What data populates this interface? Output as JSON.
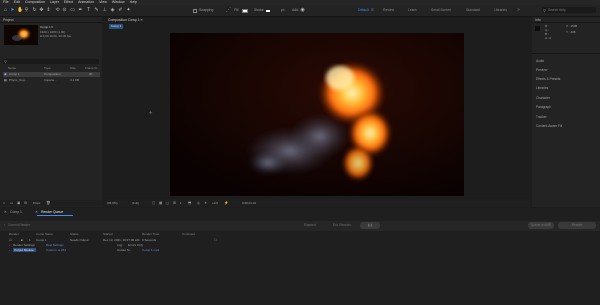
{
  "menu": [
    "File",
    "Edit",
    "Composition",
    "Layer",
    "Effect",
    "Animation",
    "View",
    "Window",
    "Help"
  ],
  "toolbar": {
    "snapping_label": "Snapping",
    "fill_label": "Fill",
    "stroke_label": "Stroke",
    "px_label": "px",
    "add_label": "Add:",
    "workspaces": [
      "Default",
      "Review",
      "Learn",
      "Small Screen",
      "Standard",
      "Libraries"
    ],
    "active_workspace": "Default",
    "search_placeholder": "Search Help"
  },
  "project": {
    "title": "Project",
    "comp_name": "Comp 1 ▾",
    "comp_size": "1920 x 1080 (1.00)",
    "comp_duration": "Δ 0;00;10;00, 30.00 fps",
    "columns": [
      "Name",
      "Type",
      "Size",
      "Frame R..."
    ],
    "items": [
      {
        "name": "Comp 1",
        "type": "Composition",
        "size": "",
        "fps": "30"
      },
      {
        "name": "Phyric_Cog...",
        "type": "Importe...",
        "size": "3.1 KB",
        "fps": ""
      }
    ],
    "bpc": "8 bpc"
  },
  "comp": {
    "tab_label": "Composition Comp 1 ≡",
    "breadcrumb": "Comp 1",
    "zoom": "(96.9%)",
    "resolution": "(Full)",
    "timecode": "0;00;01;10",
    "exposure": "+0.0"
  },
  "right_panel": {
    "info_title": "Info",
    "info_r": "R :",
    "info_g": "G :",
    "info_b": "B :",
    "info_a": "A : 0",
    "info_x": "X : 1505",
    "info_y": "Y : 408",
    "items": [
      "Audio",
      "Preview",
      "Effects & Presets",
      "Libraries",
      "Character",
      "Paragraph",
      "Tracker",
      "Content-Aware Fill"
    ]
  },
  "bottom": {
    "tabs": [
      "Comp 1",
      "Render Queue"
    ],
    "active_tab": "Render Queue",
    "current_render_label": "Current Render",
    "elapsed_label": "Elapsed:",
    "est_remain_label": "Est. Remain:",
    "queue_ame_label": "Queue in AME",
    "render_label": "Render",
    "columns": [
      "Render",
      "Comp Name",
      "Status",
      "Started",
      "Render Time",
      "Comment"
    ],
    "job": {
      "num": "1",
      "comp": "Comp 1",
      "status": "Needs Output",
      "started": "Dec 13, 2021, 10:37:00 AM",
      "render_time": "0 Seconds"
    },
    "render_settings_label": "Render Settings:",
    "render_settings_value": "Best Settings",
    "output_module_label": "Output Module:",
    "output_module_value": "Custom: H.264",
    "log_label": "Log:",
    "log_value": "Errors Only",
    "output_to_label": "Output To:",
    "output_to_value": "Comp 1.mp4"
  },
  "colors": {
    "accent": "#3d8bff",
    "panel": "#232323",
    "canvas": "#0f0403"
  }
}
